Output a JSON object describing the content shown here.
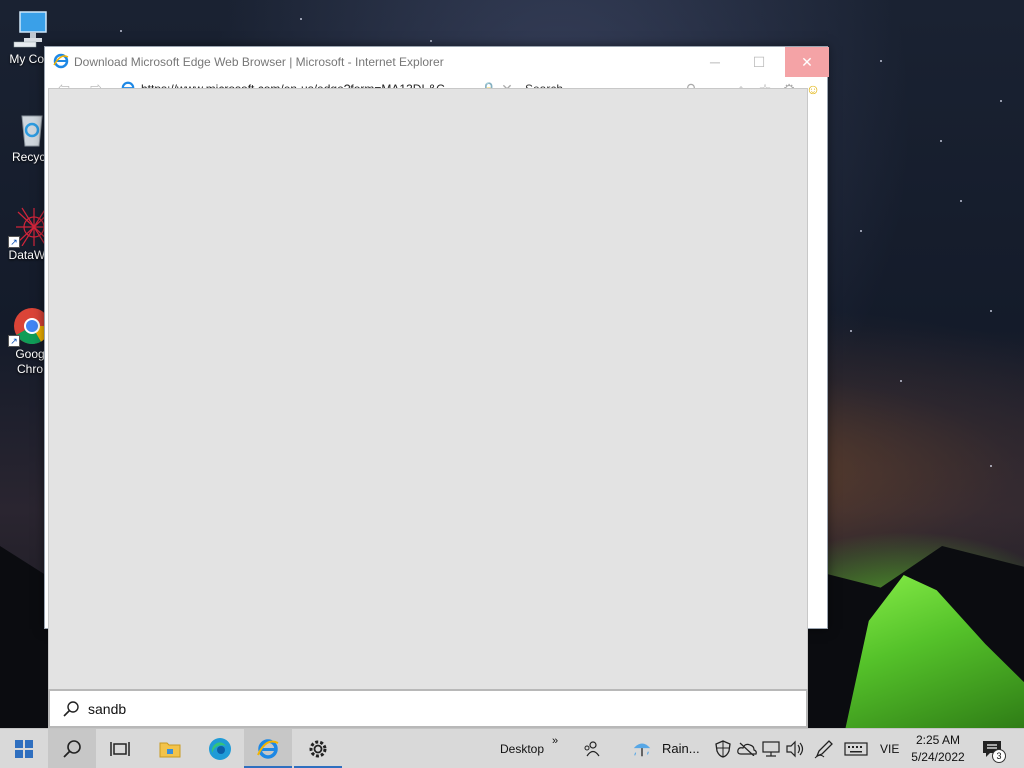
{
  "desktop": {
    "icons": [
      {
        "label": "My Con"
      },
      {
        "label": "Recycl"
      },
      {
        "label": "DataWa"
      },
      {
        "label": "Goog",
        "label2": "Chro"
      }
    ]
  },
  "ie_window": {
    "title": "Download Microsoft Edge Web Browser | Microsoft - Internet Explorer",
    "address": "https://www.microsoft.com/en-us/edge?form=MA13DL&C",
    "search_placeholder": "Search"
  },
  "search": {
    "query": "sandb"
  },
  "taskbar": {
    "desktop_label": "Desktop",
    "weather_label": "Rain...",
    "language": "VIE",
    "time": "2:25 AM",
    "date": "5/24/2022",
    "notification_count": "3",
    "accent_color": "#2f6fbf"
  }
}
